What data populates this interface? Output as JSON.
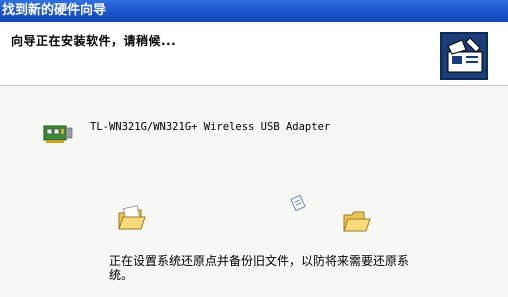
{
  "window": {
    "title": "找到新的硬件向导"
  },
  "header": {
    "text": "向导正在安装软件，请稍候...",
    "icon": "hardware-wizard-icon"
  },
  "device": {
    "name": "TL-WN321G/WN321G+ Wireless USB Adapter",
    "icon": "network-adapter-icon"
  },
  "animation": {
    "source_icon": "open-folder-icon",
    "moving_icon": "flying-document-icon",
    "target_icon": "folder-icon"
  },
  "status": {
    "text": "正在设置系统还原点并备份旧文件，以防将来需要还原系统。"
  }
}
